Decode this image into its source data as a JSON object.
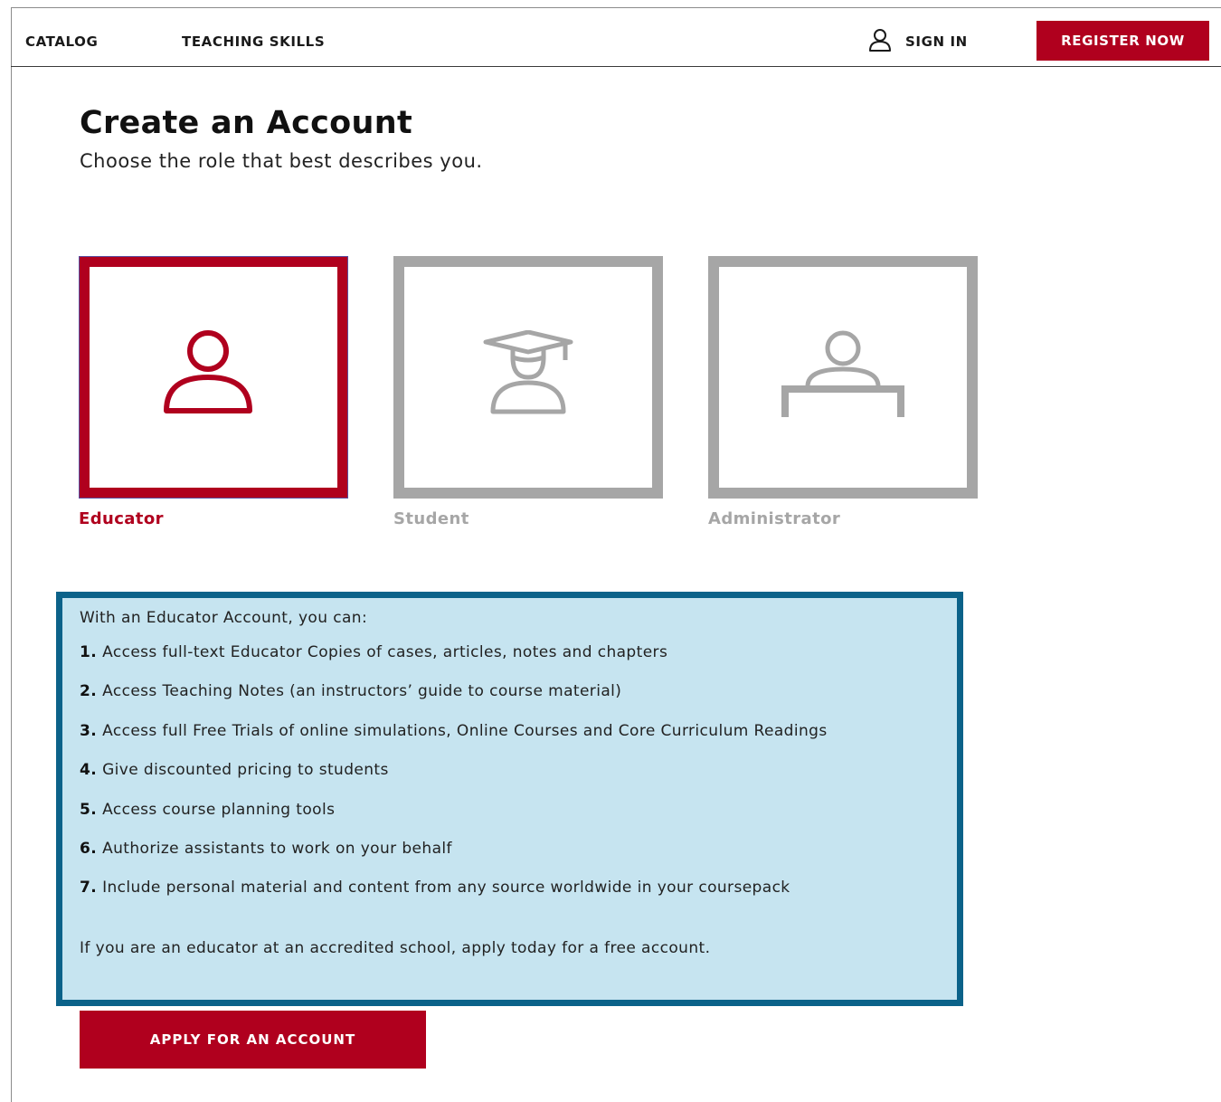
{
  "nav": {
    "links": [
      {
        "label": "CATALOG"
      },
      {
        "label": "TEACHING SKILLS"
      }
    ],
    "sign_in_label": "SIGN IN",
    "register_label": "REGISTER NOW"
  },
  "page": {
    "title": "Create an Account",
    "subtitle": "Choose the role that best describes you."
  },
  "roles": [
    {
      "label": "Educator",
      "icon": "person-icon",
      "selected": true
    },
    {
      "label": "Student",
      "icon": "graduate-cap-icon",
      "selected": false
    },
    {
      "label": "Administrator",
      "icon": "person-at-desk-icon",
      "selected": false
    }
  ],
  "info": {
    "intro": "With an Educator Account, you can:",
    "items": [
      {
        "number": "1.",
        "text": "Access full-text Educator Copies of cases, articles, notes and chapters"
      },
      {
        "number": "2.",
        "text": "Access Teaching Notes (an instructors’ guide to course material)"
      },
      {
        "number": "3.",
        "text": "Access full Free Trials of online simulations, Online Courses and Core Curriculum Readings"
      },
      {
        "number": "4.",
        "text": "Give discounted pricing to students"
      },
      {
        "number": "5.",
        "text": "Access course planning tools"
      },
      {
        "number": "6.",
        "text": "Authorize assistants to work on your behalf"
      },
      {
        "number": "7.",
        "text": "Include personal material and content from any source worldwide in your coursepack"
      }
    ],
    "closing": "If you are an educator at an accredited school, apply today for a free account."
  },
  "apply_label": "APPLY FOR AN ACCOUNT",
  "colors": {
    "brand_red": "#b0001e",
    "inactive_gray": "#a6a6a6",
    "info_background": "#c6e4f0",
    "info_border": "#0b6289"
  }
}
